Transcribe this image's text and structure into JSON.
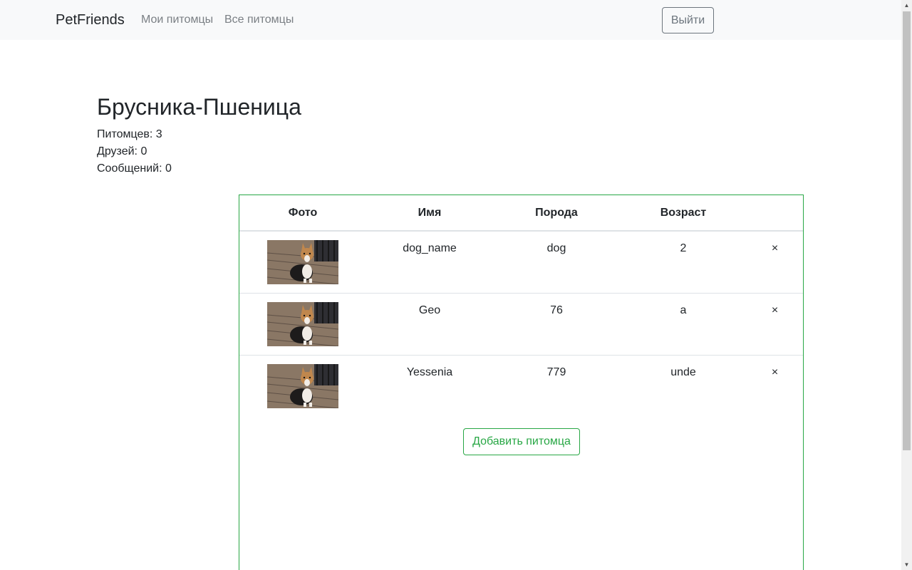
{
  "navbar": {
    "brand": "PetFriends",
    "links": [
      "Мои питомцы",
      "Все питомцы"
    ],
    "logout_label": "Выйти"
  },
  "user": {
    "name": "Брусника-Пшеница",
    "stats": [
      "Питомцев: 3",
      "Друзей: 0",
      "Сообщений: 0"
    ]
  },
  "table": {
    "headers": [
      "Фото",
      "Имя",
      "Порода",
      "Возраст"
    ],
    "rows": [
      {
        "name": "dog_name",
        "breed": "dog",
        "age": "2",
        "delete": "×"
      },
      {
        "name": "Geo",
        "breed": "76",
        "age": "a",
        "delete": "×"
      },
      {
        "name": "Yessenia",
        "breed": "779",
        "age": "unde",
        "delete": "×"
      }
    ]
  },
  "add_pet_label": "Добавить питомца",
  "colors": {
    "accent": "#28a745",
    "navbar_bg": "#f8f9fa",
    "muted": "#6c757d"
  }
}
